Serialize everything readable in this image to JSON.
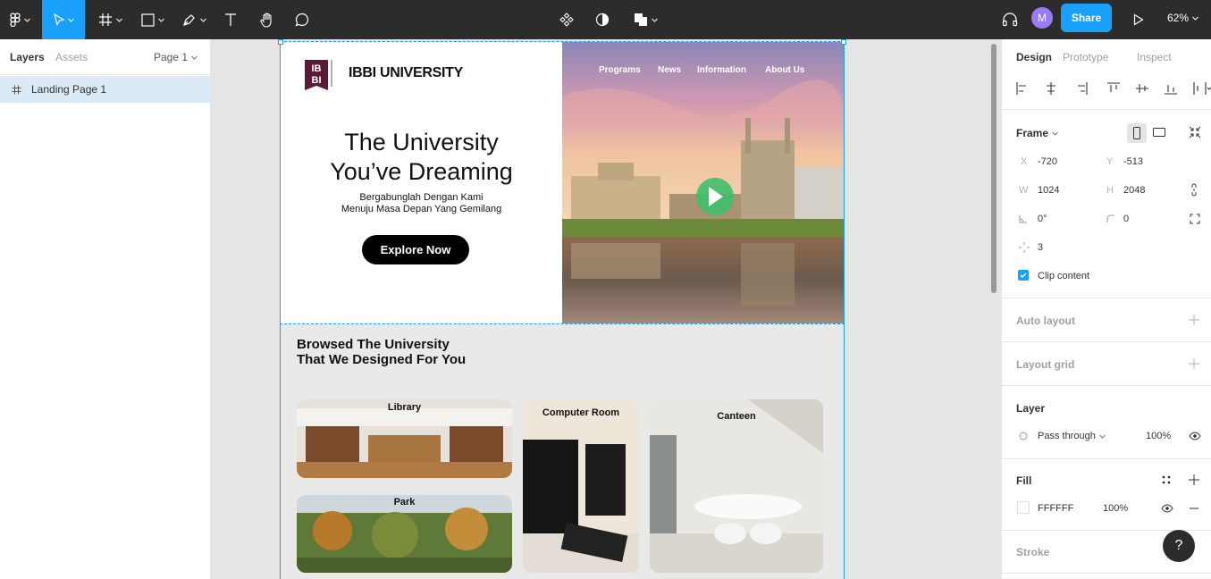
{
  "toolbar": {
    "share_label": "Share",
    "avatar_initial": "M",
    "zoom_label": "62%"
  },
  "left_panel": {
    "tabs": [
      "Layers",
      "Assets"
    ],
    "page_selector": "Page 1",
    "layers": [
      {
        "name": "Landing Page 1",
        "selected": true
      }
    ]
  },
  "canvas": {
    "site": {
      "logo_text": "IBBI UNIVERSITY",
      "logo_mark": "IB BI",
      "nav_items": [
        "Programs",
        "News",
        "Information",
        "About Us"
      ],
      "hero_title_line1": "The University",
      "hero_title_line2": "You’ve Dreaming",
      "hero_sub_line1": "Bergabunglah Dengan Kami",
      "hero_sub_line2": "Menuju Masa Depan Yang Gemilang",
      "cta_label": "Explore Now",
      "section_title_line1": "Browsed The University",
      "section_title_line2": "That We Designed For You",
      "cards": [
        "Library",
        "Computer Room",
        "Canteen",
        "Park"
      ]
    }
  },
  "right_panel": {
    "tabs": [
      "Design",
      "Prototype",
      "Inspect"
    ],
    "frame": {
      "title": "Frame",
      "x_label": "X",
      "x_value": "-720",
      "y_label": "Y",
      "y_value": "-513",
      "w_label": "W",
      "w_value": "1024",
      "h_label": "H",
      "h_value": "2048",
      "rotation": "0°",
      "corner_radius": "0",
      "spacing": "3",
      "clip_content_label": "Clip content",
      "clip_content_checked": true
    },
    "auto_layout_title": "Auto layout",
    "layout_grid_title": "Layout grid",
    "layer": {
      "title": "Layer",
      "blend_mode": "Pass through",
      "opacity": "100%"
    },
    "fill": {
      "title": "Fill",
      "hex": "FFFFFF",
      "opacity": "100%"
    },
    "stroke_title": "Stroke",
    "help_label": "?"
  },
  "colors": {
    "accent": "#18a0fb",
    "toolbar_bg": "#2c2c2c",
    "selection_bg": "#daebf7"
  }
}
